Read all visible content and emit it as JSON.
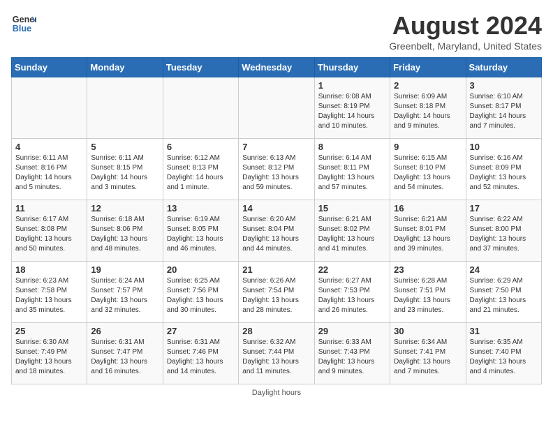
{
  "header": {
    "logo_line1": "General",
    "logo_line2": "Blue",
    "main_title": "August 2024",
    "subtitle": "Greenbelt, Maryland, United States"
  },
  "days_of_week": [
    "Sunday",
    "Monday",
    "Tuesday",
    "Wednesday",
    "Thursday",
    "Friday",
    "Saturday"
  ],
  "footer": "Daylight hours",
  "weeks": [
    [
      {
        "day": "",
        "text": ""
      },
      {
        "day": "",
        "text": ""
      },
      {
        "day": "",
        "text": ""
      },
      {
        "day": "",
        "text": ""
      },
      {
        "day": "1",
        "text": "Sunrise: 6:08 AM\nSunset: 8:19 PM\nDaylight: 14 hours\nand 10 minutes."
      },
      {
        "day": "2",
        "text": "Sunrise: 6:09 AM\nSunset: 8:18 PM\nDaylight: 14 hours\nand 9 minutes."
      },
      {
        "day": "3",
        "text": "Sunrise: 6:10 AM\nSunset: 8:17 PM\nDaylight: 14 hours\nand 7 minutes."
      }
    ],
    [
      {
        "day": "4",
        "text": "Sunrise: 6:11 AM\nSunset: 8:16 PM\nDaylight: 14 hours\nand 5 minutes."
      },
      {
        "day": "5",
        "text": "Sunrise: 6:11 AM\nSunset: 8:15 PM\nDaylight: 14 hours\nand 3 minutes."
      },
      {
        "day": "6",
        "text": "Sunrise: 6:12 AM\nSunset: 8:13 PM\nDaylight: 14 hours\nand 1 minute."
      },
      {
        "day": "7",
        "text": "Sunrise: 6:13 AM\nSunset: 8:12 PM\nDaylight: 13 hours\nand 59 minutes."
      },
      {
        "day": "8",
        "text": "Sunrise: 6:14 AM\nSunset: 8:11 PM\nDaylight: 13 hours\nand 57 minutes."
      },
      {
        "day": "9",
        "text": "Sunrise: 6:15 AM\nSunset: 8:10 PM\nDaylight: 13 hours\nand 54 minutes."
      },
      {
        "day": "10",
        "text": "Sunrise: 6:16 AM\nSunset: 8:09 PM\nDaylight: 13 hours\nand 52 minutes."
      }
    ],
    [
      {
        "day": "11",
        "text": "Sunrise: 6:17 AM\nSunset: 8:08 PM\nDaylight: 13 hours\nand 50 minutes."
      },
      {
        "day": "12",
        "text": "Sunrise: 6:18 AM\nSunset: 8:06 PM\nDaylight: 13 hours\nand 48 minutes."
      },
      {
        "day": "13",
        "text": "Sunrise: 6:19 AM\nSunset: 8:05 PM\nDaylight: 13 hours\nand 46 minutes."
      },
      {
        "day": "14",
        "text": "Sunrise: 6:20 AM\nSunset: 8:04 PM\nDaylight: 13 hours\nand 44 minutes."
      },
      {
        "day": "15",
        "text": "Sunrise: 6:21 AM\nSunset: 8:02 PM\nDaylight: 13 hours\nand 41 minutes."
      },
      {
        "day": "16",
        "text": "Sunrise: 6:21 AM\nSunset: 8:01 PM\nDaylight: 13 hours\nand 39 minutes."
      },
      {
        "day": "17",
        "text": "Sunrise: 6:22 AM\nSunset: 8:00 PM\nDaylight: 13 hours\nand 37 minutes."
      }
    ],
    [
      {
        "day": "18",
        "text": "Sunrise: 6:23 AM\nSunset: 7:58 PM\nDaylight: 13 hours\nand 35 minutes."
      },
      {
        "day": "19",
        "text": "Sunrise: 6:24 AM\nSunset: 7:57 PM\nDaylight: 13 hours\nand 32 minutes."
      },
      {
        "day": "20",
        "text": "Sunrise: 6:25 AM\nSunset: 7:56 PM\nDaylight: 13 hours\nand 30 minutes."
      },
      {
        "day": "21",
        "text": "Sunrise: 6:26 AM\nSunset: 7:54 PM\nDaylight: 13 hours\nand 28 minutes."
      },
      {
        "day": "22",
        "text": "Sunrise: 6:27 AM\nSunset: 7:53 PM\nDaylight: 13 hours\nand 26 minutes."
      },
      {
        "day": "23",
        "text": "Sunrise: 6:28 AM\nSunset: 7:51 PM\nDaylight: 13 hours\nand 23 minutes."
      },
      {
        "day": "24",
        "text": "Sunrise: 6:29 AM\nSunset: 7:50 PM\nDaylight: 13 hours\nand 21 minutes."
      }
    ],
    [
      {
        "day": "25",
        "text": "Sunrise: 6:30 AM\nSunset: 7:49 PM\nDaylight: 13 hours\nand 18 minutes."
      },
      {
        "day": "26",
        "text": "Sunrise: 6:31 AM\nSunset: 7:47 PM\nDaylight: 13 hours\nand 16 minutes."
      },
      {
        "day": "27",
        "text": "Sunrise: 6:31 AM\nSunset: 7:46 PM\nDaylight: 13 hours\nand 14 minutes."
      },
      {
        "day": "28",
        "text": "Sunrise: 6:32 AM\nSunset: 7:44 PM\nDaylight: 13 hours\nand 11 minutes."
      },
      {
        "day": "29",
        "text": "Sunrise: 6:33 AM\nSunset: 7:43 PM\nDaylight: 13 hours\nand 9 minutes."
      },
      {
        "day": "30",
        "text": "Sunrise: 6:34 AM\nSunset: 7:41 PM\nDaylight: 13 hours\nand 7 minutes."
      },
      {
        "day": "31",
        "text": "Sunrise: 6:35 AM\nSunset: 7:40 PM\nDaylight: 13 hours\nand 4 minutes."
      }
    ]
  ]
}
